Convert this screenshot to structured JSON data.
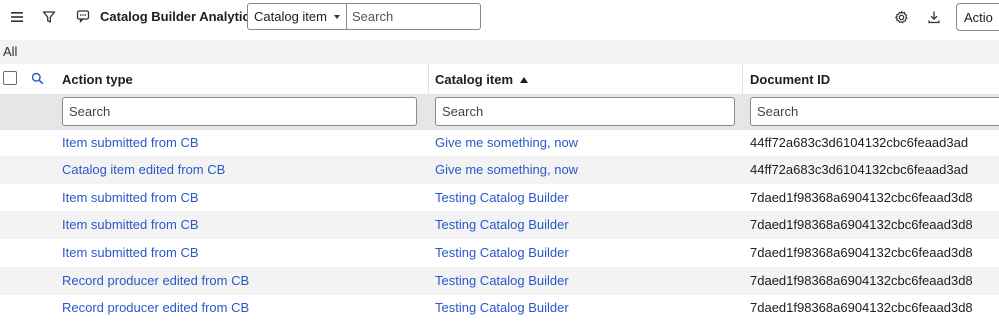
{
  "toolbar": {
    "title": "Catalog Builder Analytics",
    "select_value": "Catalog item",
    "search_placeholder": "Search",
    "actions_label": "Actio"
  },
  "breadcrumb": {
    "label": "All"
  },
  "columns": [
    {
      "label": "Action type"
    },
    {
      "label": "Catalog item"
    },
    {
      "label": "Document ID"
    }
  ],
  "column_search": {
    "placeholder": "Search"
  },
  "rows": [
    {
      "action_type": "Item submitted from CB",
      "catalog_item": "Give me something, now",
      "document_id": "44ff72a683c3d6104132cbc6feaad3ad"
    },
    {
      "action_type": "Catalog item edited from CB",
      "catalog_item": "Give me something, now",
      "document_id": "44ff72a683c3d6104132cbc6feaad3ad"
    },
    {
      "action_type": "Item submitted from CB",
      "catalog_item": "Testing Catalog Builder",
      "document_id": "7daed1f98368a6904132cbc6feaad3d8"
    },
    {
      "action_type": "Item submitted from CB",
      "catalog_item": "Testing Catalog Builder",
      "document_id": "7daed1f98368a6904132cbc6feaad3d8"
    },
    {
      "action_type": "Item submitted from CB",
      "catalog_item": "Testing Catalog Builder",
      "document_id": "7daed1f98368a6904132cbc6feaad3d8"
    },
    {
      "action_type": "Record producer edited from CB",
      "catalog_item": "Testing Catalog Builder",
      "document_id": "7daed1f98368a6904132cbc6feaad3d8"
    },
    {
      "action_type": "Record producer edited from CB",
      "catalog_item": "Testing Catalog Builder",
      "document_id": "7daed1f98368a6904132cbc6feaad3d8"
    }
  ],
  "icons": {
    "menu": "hamburger-menu-icon",
    "filter": "funnel-icon",
    "context": "context-menu-icon",
    "settings": "gear-icon",
    "download": "download-icon",
    "column_search": "magnifier-icon",
    "sort": "sort-ascending-icon"
  },
  "colors": {
    "link": "#2a57c9",
    "filter_row_bg": "#e6e6e8",
    "alt_row_bg": "#f3f3f4"
  }
}
